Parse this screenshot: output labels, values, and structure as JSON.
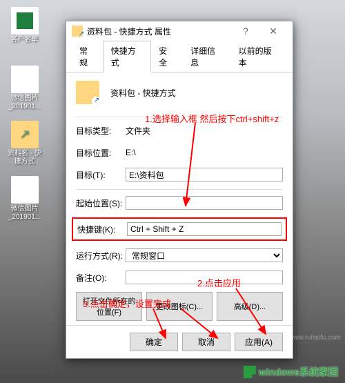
{
  "desktop": {
    "icons": [
      {
        "label": "客户名单"
      },
      {
        "label": "微信图片_201901..."
      },
      {
        "label": "资料名 - 快捷方式"
      },
      {
        "label": "微信图片_201901..."
      }
    ]
  },
  "dialog": {
    "title": "资料包 - 快捷方式 属性",
    "tabs": [
      "常规",
      "快捷方式",
      "安全",
      "详细信息",
      "以前的版本"
    ],
    "active_tab": 1,
    "header_name": "资料包 - 快捷方式",
    "fields": {
      "type_label": "目标类型:",
      "type_value": "文件夹",
      "loc_label": "目标位置:",
      "loc_value": "E:\\",
      "target_label": "目标(T):",
      "target_value": "E:\\资料包",
      "start_label": "起始位置(S):",
      "start_value": "",
      "shortcut_label": "快捷键(K):",
      "shortcut_value": "Ctrl + Shift + Z",
      "run_label": "运行方式(R):",
      "run_value": "常规窗口",
      "comment_label": "备注(O):",
      "comment_value": ""
    },
    "buttons": {
      "open_loc": "打开文件所在的位置(F)",
      "change_icon": "更改图标(C)...",
      "advanced": "高级(D)..."
    },
    "footer": {
      "ok": "确定",
      "cancel": "取消",
      "apply": "应用(A)"
    }
  },
  "annotations": {
    "a1": "1.选择输入框 然后按下ctrl+shift+z",
    "a2": "2.点击应用",
    "a3": "3.点击确定，设置完成"
  },
  "branding": {
    "text": "windows系统家园",
    "url": "www.ruhaifu.com"
  }
}
